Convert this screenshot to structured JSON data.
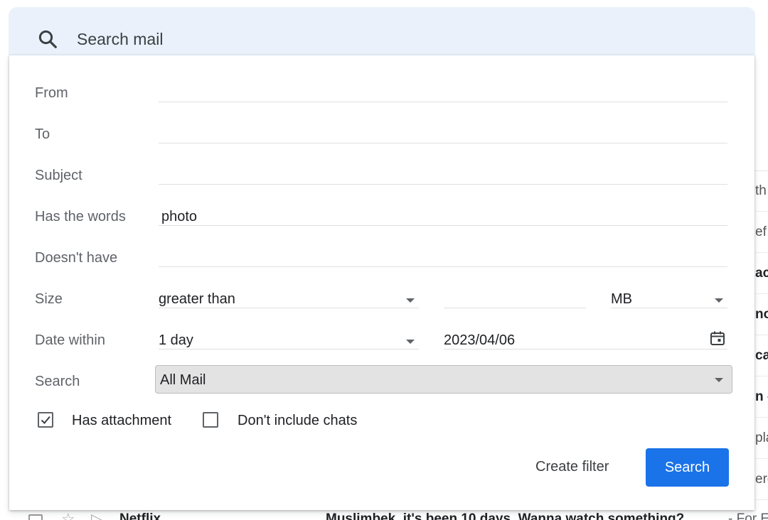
{
  "search": {
    "placeholder": "Search mail",
    "icon": "search-icon"
  },
  "form": {
    "from_label": "From",
    "to_label": "To",
    "subject_label": "Subject",
    "has_words_label": "Has the words",
    "has_words_value": "photo",
    "doesnt_have_label": "Doesn't have",
    "size_label": "Size",
    "size_operator": "greater than",
    "size_unit": "MB",
    "date_within_label": "Date within",
    "date_within_value": "1 day",
    "date_value": "2023/04/06",
    "search_scope_label": "Search",
    "search_scope_value": "All Mail",
    "has_attachment_label": "Has attachment",
    "has_attachment_checked": true,
    "dont_include_chats_label": "Don't include chats",
    "dont_include_chats_checked": false
  },
  "actions": {
    "create_filter_label": "Create filter",
    "search_label": "Search",
    "accent_color": "#1a73e8"
  },
  "background": {
    "right_fragments": [
      "th",
      "ef",
      "ac",
      "no",
      "ca",
      "n -",
      "pla",
      "ere"
    ],
    "bottom_row": {
      "sender": "Netflix",
      "subject": "Muslimbek, it's been 10 days. Wanna watch something?",
      "snippet": "- For El"
    }
  }
}
